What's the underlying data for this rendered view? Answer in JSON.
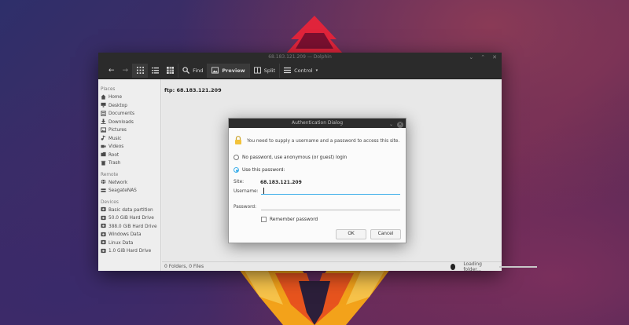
{
  "window": {
    "title": "68.183.121.209 — Dolphin",
    "controls": [
      "⌄",
      "⌃",
      "✕"
    ]
  },
  "toolbar": {
    "back_icon": "←",
    "forward_icon": "→",
    "find_label": "Find",
    "preview_label": "Preview",
    "split_label": "Split",
    "control_label": "Control"
  },
  "sidebar": {
    "places_header": "Places",
    "places": [
      {
        "label": "Home",
        "icon": "home-icon"
      },
      {
        "label": "Desktop",
        "icon": "desktop-icon"
      },
      {
        "label": "Documents",
        "icon": "documents-icon"
      },
      {
        "label": "Downloads",
        "icon": "downloads-icon"
      },
      {
        "label": "Pictures",
        "icon": "pictures-icon"
      },
      {
        "label": "Music",
        "icon": "music-icon"
      },
      {
        "label": "Videos",
        "icon": "videos-icon"
      },
      {
        "label": "Root",
        "icon": "root-icon"
      },
      {
        "label": "Trash",
        "icon": "trash-icon"
      }
    ],
    "remote_header": "Remote",
    "remote": [
      {
        "label": "Network",
        "icon": "network-icon"
      },
      {
        "label": "SeagateNAS",
        "icon": "nas-icon"
      }
    ],
    "devices_header": "Devices",
    "devices": [
      {
        "label": "Basic data partition",
        "icon": "drive-icon"
      },
      {
        "label": "50.0 GiB Hard Drive",
        "icon": "drive-icon"
      },
      {
        "label": "388.0 GiB Hard Drive",
        "icon": "drive-icon"
      },
      {
        "label": "Windows Data",
        "icon": "drive-icon"
      },
      {
        "label": "Linux Data",
        "icon": "drive-icon"
      },
      {
        "label": "1.0 GiB Hard Drive",
        "icon": "drive-icon"
      }
    ]
  },
  "content": {
    "path": "ftp: 68.183.121.209"
  },
  "status": {
    "summary": "0 Folders, 0 Files",
    "loading": "Loading folder..."
  },
  "dialog": {
    "title": "Authentication Dialog",
    "message": "You need to supply a username and a password to access this site.",
    "anonymous_label": "No password, use anonymous (or guest) login",
    "use_password_label": "Use this password:",
    "site_label": "Site:",
    "site_value": "68.183.121.209",
    "username_label": "Username:",
    "password_label": "Password:",
    "remember_label": "Remember password",
    "ok_label": "OK",
    "cancel_label": "Cancel",
    "selected_option": "use_password"
  },
  "colors": {
    "accent": "#3daee9",
    "titlebar": "#2b2b2b"
  }
}
